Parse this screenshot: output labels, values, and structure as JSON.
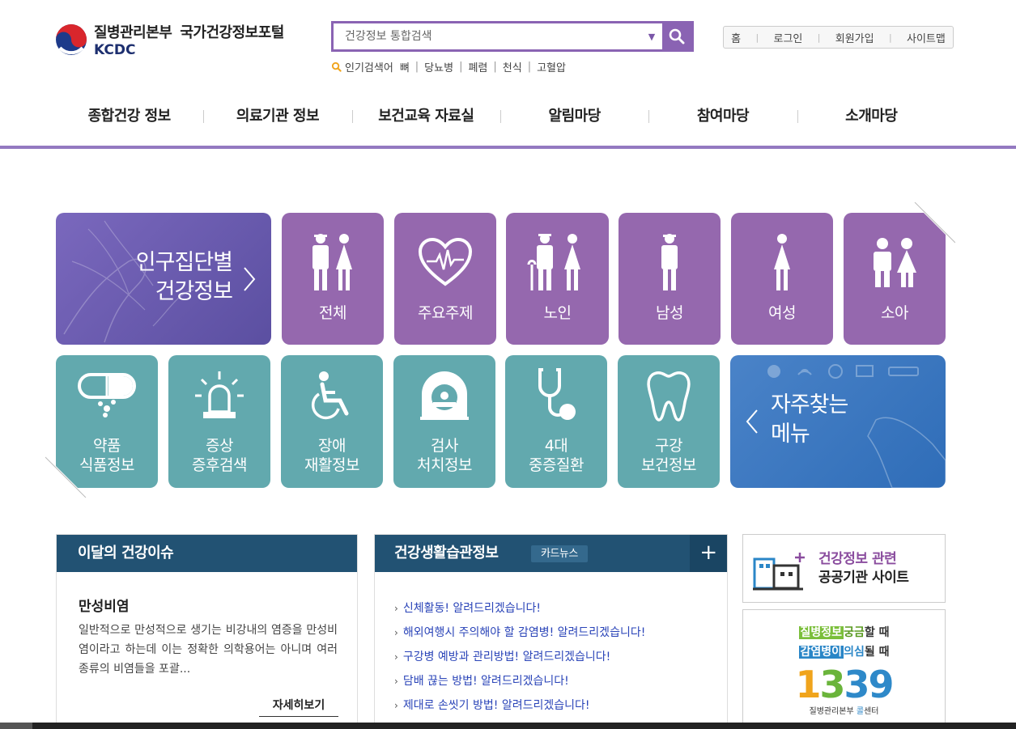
{
  "header": {
    "org_name": "질병관리본부",
    "portal_name": "국가건강정보포털",
    "org_abbr": "KCDC",
    "search_placeholder": "건강정보 통합검색",
    "popular_label": "인기검색어",
    "popular_keywords": [
      "뼈",
      "당뇨병",
      "폐렴",
      "천식",
      "고혈압"
    ],
    "util_links": [
      "홈",
      "로그인",
      "회원가입",
      "사이트맵"
    ]
  },
  "gnb": [
    "종합건강 정보",
    "의료기관 정보",
    "보건교육 자료실",
    "알림마당",
    "참여마당",
    "소개마당"
  ],
  "population": {
    "banner_line1": "인구집단별",
    "banner_line2": "건강정보",
    "tiles": [
      {
        "label": "전체",
        "icon": "family-icon"
      },
      {
        "label": "주요주제",
        "icon": "heart-pulse-icon"
      },
      {
        "label": "노인",
        "icon": "elderly-couple-icon"
      },
      {
        "label": "남성",
        "icon": "man-icon"
      },
      {
        "label": "여성",
        "icon": "woman-icon"
      },
      {
        "label": "소아",
        "icon": "children-icon"
      }
    ]
  },
  "categories": {
    "tiles": [
      {
        "line1": "약품",
        "line2": "식품정보",
        "icon": "pill-icon"
      },
      {
        "line1": "증상",
        "line2": "증후검색",
        "icon": "siren-icon"
      },
      {
        "line1": "장애",
        "line2": "재활정보",
        "icon": "wheelchair-icon"
      },
      {
        "line1": "검사",
        "line2": "처치정보",
        "icon": "mri-scanner-icon"
      },
      {
        "line1": "4대",
        "line2": "중증질환",
        "icon": "stethoscope-icon"
      },
      {
        "line1": "구강",
        "line2": "보건정보",
        "icon": "tooth-icon"
      }
    ],
    "banner_line1": "자주찾는",
    "banner_line2": "메뉴"
  },
  "monthly_issue": {
    "heading": "이달의 건강이슈",
    "title": "만성비염",
    "description": "일반적으로 만성적으로 생기는 비강내의 염증을 만성비염이라고 하는데 이는 정확한 의학용어는 아니며 여러 종류의 비염들을 포괄...",
    "more_label": "자세히보기"
  },
  "lifestyle": {
    "heading": "건강생활습관정보",
    "badge": "카드뉴스",
    "plus_label": "+",
    "items": [
      "신체활동! 알려드리겠습니다!",
      "해외여행시 주의해야 할 감염병! 알려드리겠습니다!",
      "구강병 예방과 관리방법! 알려드리겠습니다!",
      "담배 끊는 방법! 알려드리겠습니다!",
      "제대로 손씻기 방법! 알려드리겠습니다!"
    ]
  },
  "public_sites": {
    "line1": "건강정보 관련",
    "line2": "공공기관 사이트"
  },
  "callcenter": {
    "l1_hl": "질병정보",
    "l1_mid": "궁금",
    "l1_end": "할 때",
    "l2_hl": "감염병이",
    "l2_mid": "의심",
    "l2_end": "될 때",
    "digits": [
      "1",
      "3",
      "3",
      "9"
    ],
    "caption_a": "질병관리본부 ",
    "caption_b": "콜",
    "caption_c": "센터"
  }
}
